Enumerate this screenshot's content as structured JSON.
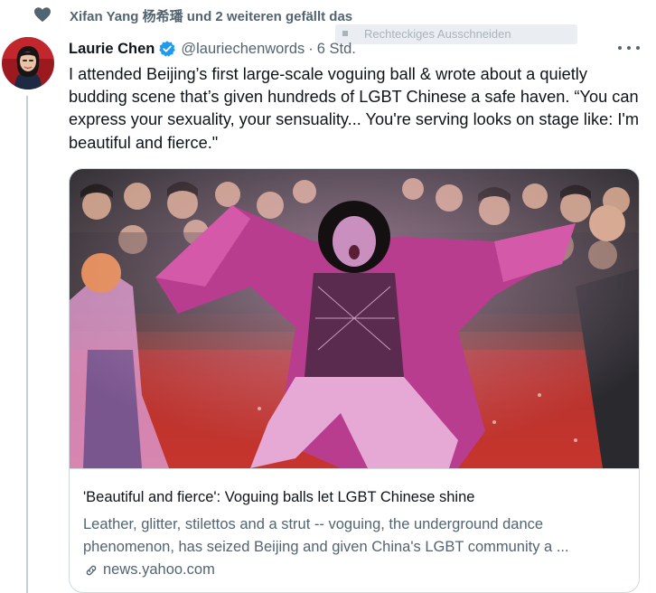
{
  "social_context": {
    "text": "Xifan Yang 杨希璠 und 2 weiteren gefällt das",
    "icon": "heart-icon"
  },
  "ghost_tooltip": {
    "text": "Rechteckiges Ausschneiden"
  },
  "tweet": {
    "author_name": "Laurie Chen",
    "handle": "@lauriechenwords",
    "separator": "·",
    "time": "6 Std.",
    "text": "I attended Beijing’s first large-scale voguing ball & wrote about a quietly budding scene that’s given hundreds of LGBT Chinese a safe haven. “You can express your sexuality, your sensuality... You're serving looks on stage like: I'm beautiful and fierce.\""
  },
  "card": {
    "title": "'Beautiful and fierce': Voguing balls let LGBT Chinese shine",
    "description_line1": "Leather, glitter, stilettos and a strut -- voguing, the underground dance",
    "description_line2": "phenomenon, has seized Beijing and given China's LGBT community a ...",
    "domain": "news.yahoo.com"
  },
  "colors": {
    "text_primary": "#0f1419",
    "text_secondary": "#536471",
    "verified_blue": "#1d9bf0",
    "border": "#cfd9de"
  }
}
